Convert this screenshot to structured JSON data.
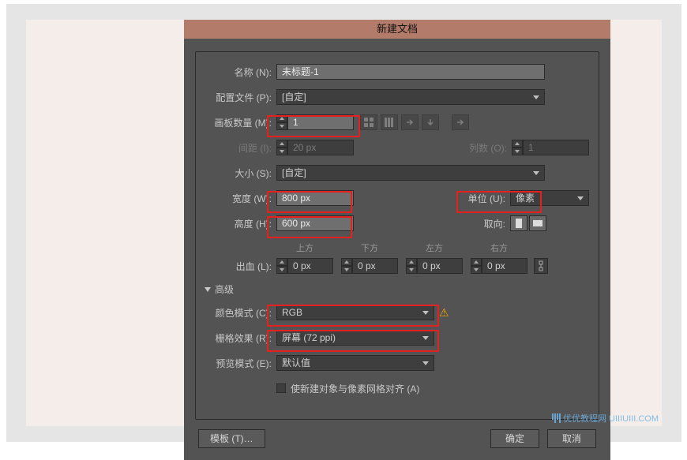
{
  "title": "新建文档",
  "labels": {
    "name": "名称 (N):",
    "profile": "配置文件 (P):",
    "artboards": "画板数量 (M):",
    "spacing": "间距 (I):",
    "columns": "列数 (O):",
    "size": "大小 (S):",
    "width": "宽度 (W):",
    "units": "单位 (U):",
    "height": "高度 (H):",
    "orientation": "取向:",
    "bleed": "出血 (L):",
    "top": "上方",
    "bottom": "下方",
    "left": "左方",
    "right": "右方",
    "advanced": "高级",
    "colormode": "颜色模式 (C):",
    "raster": "栅格效果 (R):",
    "preview": "预览模式 (E):",
    "align_check": "使新建对象与像素网格对齐 (A)"
  },
  "values": {
    "name": "未标题-1",
    "profile": "[自定]",
    "artboards": "1",
    "spacing": "20 px",
    "columns": "1",
    "size": "[自定]",
    "width": "800 px",
    "height": "600 px",
    "units": "像素",
    "bleed_top": "0 px",
    "bleed_bottom": "0 px",
    "bleed_left": "0 px",
    "bleed_right": "0 px",
    "colormode": "RGB",
    "raster": "屏幕 (72 ppi)",
    "preview": "默认值"
  },
  "buttons": {
    "template": "模板 (T)…",
    "ok": "确定",
    "cancel": "取消"
  },
  "watermark": "优优教程网 UIIIUIII.COM"
}
